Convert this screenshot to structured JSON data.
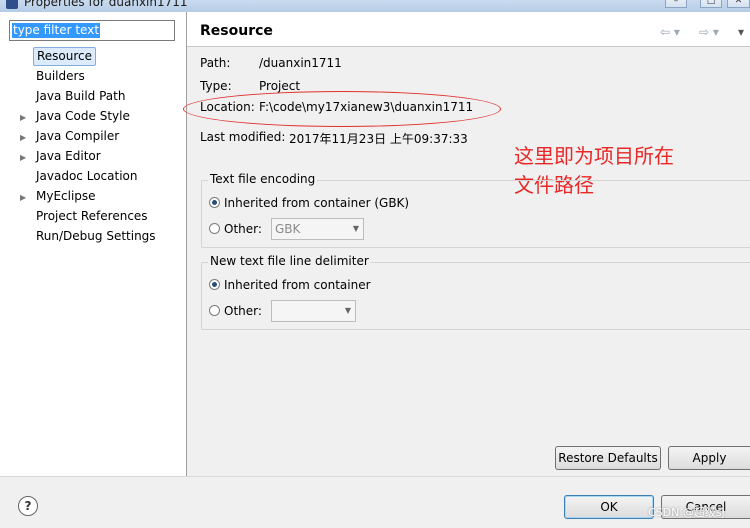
{
  "window": {
    "title": "Properties for duanxin1711"
  },
  "filter": {
    "value": "type filter text"
  },
  "tree": [
    {
      "label": "Resource",
      "arrow": "",
      "selected": true
    },
    {
      "label": "Builders",
      "arrow": ""
    },
    {
      "label": "Java Build Path",
      "arrow": ""
    },
    {
      "label": "Java Code Style",
      "arrow": "▶"
    },
    {
      "label": "Java Compiler",
      "arrow": "▶"
    },
    {
      "label": "Java Editor",
      "arrow": "▶"
    },
    {
      "label": "Javadoc Location",
      "arrow": ""
    },
    {
      "label": "MyEclipse",
      "arrow": "▶"
    },
    {
      "label": "Project References",
      "arrow": ""
    },
    {
      "label": "Run/Debug Settings",
      "arrow": ""
    }
  ],
  "page": {
    "title": "Resource",
    "path_label": "Path:",
    "path_value": "/duanxin1711",
    "type_label": "Type:",
    "type_value": "Project",
    "location_label": "Location:",
    "location_value": "F:\\code\\my17xianew3\\duanxin1711",
    "modified_label": "Last modified:",
    "modified_value": "2017年11月23日 上午09:37:33",
    "annotation_line1": "这里即为项目所在",
    "annotation_line2": "文件路径"
  },
  "encoding": {
    "title": "Text file encoding",
    "inherited": "Inherited from container (GBK)",
    "other": "Other:",
    "other_value": "GBK"
  },
  "delimiter": {
    "title": "New text file line delimiter",
    "inherited": "Inherited from container",
    "other": "Other:"
  },
  "buttons": {
    "restore": "Restore Defaults",
    "apply": "Apply",
    "ok": "OK",
    "cancel": "Cancel",
    "help": "?"
  },
  "watermark": "CSDN @超级sj",
  "colors": {
    "annotation": "#e82727",
    "selection": "#3399ff"
  }
}
